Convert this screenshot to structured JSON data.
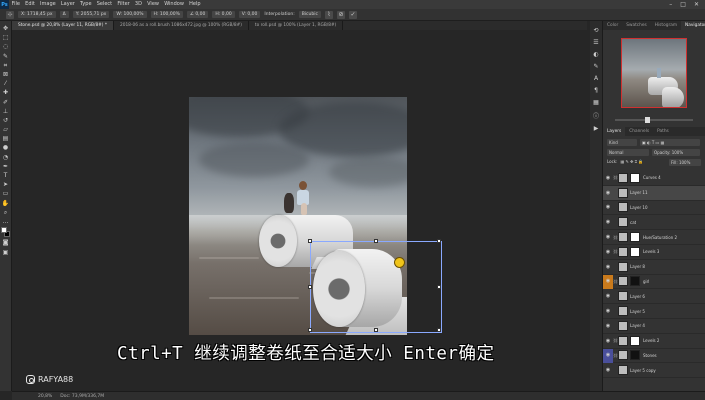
{
  "menubar": {
    "logo": "Ps",
    "items": [
      "File",
      "Edit",
      "Image",
      "Layer",
      "Type",
      "Select",
      "Filter",
      "3D",
      "View",
      "Window",
      "Help"
    ]
  },
  "options": {
    "fields": [
      "X: 1718,45 px",
      "Δ",
      "Y: 2055,71 px",
      "W: 100,00%",
      "H: 100,00%",
      "∠ 0,00",
      "H: 0,00",
      "V: 0,00",
      "Interpolation:",
      "Bicubic"
    ],
    "cancel": "⊘",
    "commit": "✓"
  },
  "tabs": [
    {
      "label": "Stone.psd @ 20,8% (Layer 11, RGB/8#) *",
      "active": true
    },
    {
      "label": "2018-06 as a roll.brush 1086x472.jpg @ 100% (RGB/8#)",
      "active": false
    },
    {
      "label": "to roll.psd @ 100% (Layer 1, RGB/8#)",
      "active": false
    }
  ],
  "panels": {
    "top_tabs": [
      "Color",
      "Swatches",
      "Histogram",
      "Navigator"
    ],
    "layer_tabs": [
      "Layers",
      "Channels",
      "Paths"
    ],
    "kind": "Kind",
    "blend": "Normal",
    "opacity": "Opacity: 100%",
    "lock": "Lock:",
    "fill": "Fill: 100%"
  },
  "layers": [
    {
      "name": "Curves 4",
      "mask": "white",
      "selected": false,
      "tag": ""
    },
    {
      "name": "Layer 11",
      "mask": "",
      "selected": true,
      "tag": ""
    },
    {
      "name": "Layer 10",
      "mask": "",
      "selected": false,
      "tag": ""
    },
    {
      "name": "cat",
      "mask": "",
      "selected": false,
      "tag": ""
    },
    {
      "name": "Hue/Saturation 2",
      "mask": "white",
      "selected": false,
      "tag": ""
    },
    {
      "name": "Levels 3",
      "mask": "white",
      "selected": false,
      "tag": ""
    },
    {
      "name": "Layer 8",
      "mask": "",
      "selected": false,
      "tag": ""
    },
    {
      "name": "girl",
      "mask": "black",
      "selected": false,
      "tag": "#c97a1c"
    },
    {
      "name": "Layer 6",
      "mask": "",
      "selected": false,
      "tag": ""
    },
    {
      "name": "Layer 5",
      "mask": "",
      "selected": false,
      "tag": ""
    },
    {
      "name": "Layer 4",
      "mask": "",
      "selected": false,
      "tag": ""
    },
    {
      "name": "Levels 2",
      "mask": "white",
      "selected": false,
      "tag": ""
    },
    {
      "name": "Stones",
      "mask": "black",
      "selected": false,
      "tag": "#4a4f9a"
    },
    {
      "name": "Layer 5 copy",
      "mask": "",
      "selected": false,
      "tag": ""
    }
  ],
  "status": {
    "zoom": "20,8%",
    "doc": "Doc: 73,9M/336,7M"
  },
  "subtitle": "Ctrl+T 继续调整卷纸至合适大小 Enter确定",
  "watermark": "RAFYA88",
  "colors": {
    "accent": "#31a8ff",
    "transform_box": "#8aa9ff",
    "cursor": "#f0c419"
  }
}
